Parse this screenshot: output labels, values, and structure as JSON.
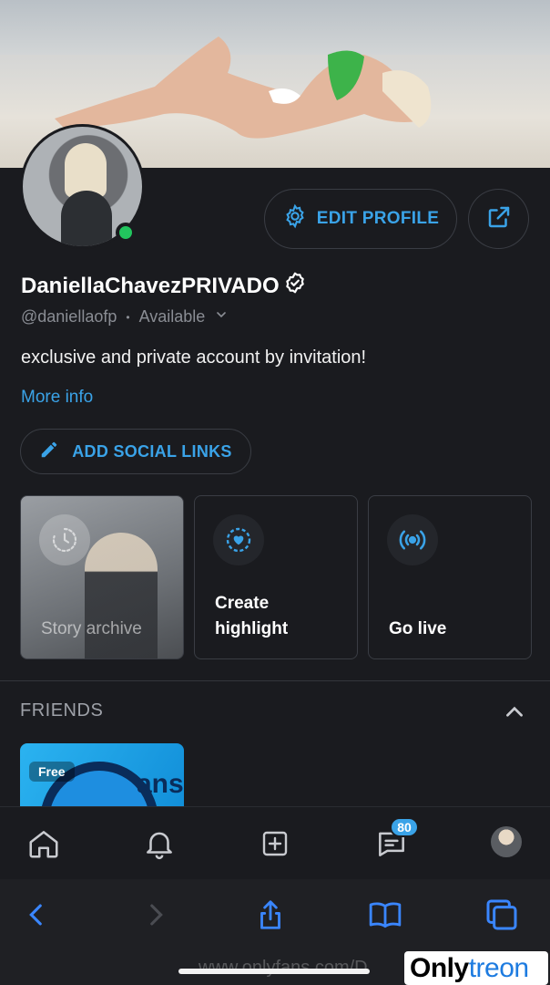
{
  "profile": {
    "display_name": "DaniellaChavezPRIVADO",
    "handle": "@daniellaofp",
    "separator": "•",
    "status": "Available",
    "bio": "exclusive and private account by invitation!",
    "more_info": "More info",
    "online": true
  },
  "actions": {
    "edit_profile": "EDIT PROFILE",
    "add_social_links": "ADD SOCIAL LINKS"
  },
  "cards": [
    {
      "label": "Story archive",
      "icon": "clock-icon"
    },
    {
      "label_line1": "Create",
      "label_line2": "highlight",
      "icon": "heart-highlight-icon"
    },
    {
      "label": "Go live",
      "icon": "broadcast-icon"
    }
  ],
  "friends": {
    "title": "FRIENDS",
    "card_badge": "Free",
    "card_text": "ans"
  },
  "tabbar": {
    "messages_badge": "80",
    "icons": [
      "home-icon",
      "bell-icon",
      "plus-square-icon",
      "messages-icon",
      "avatar"
    ]
  },
  "safari": {
    "url": "www.onlyfans.com/D",
    "icons": [
      "back-icon",
      "forward-icon",
      "share-icon",
      "bookmarks-icon",
      "tabs-icon"
    ]
  },
  "watermark": {
    "only": "Only",
    "treon": "treon"
  },
  "colors": {
    "accent": "#3aa3e8",
    "background": "#1a1b1f",
    "online": "#22c55e"
  }
}
